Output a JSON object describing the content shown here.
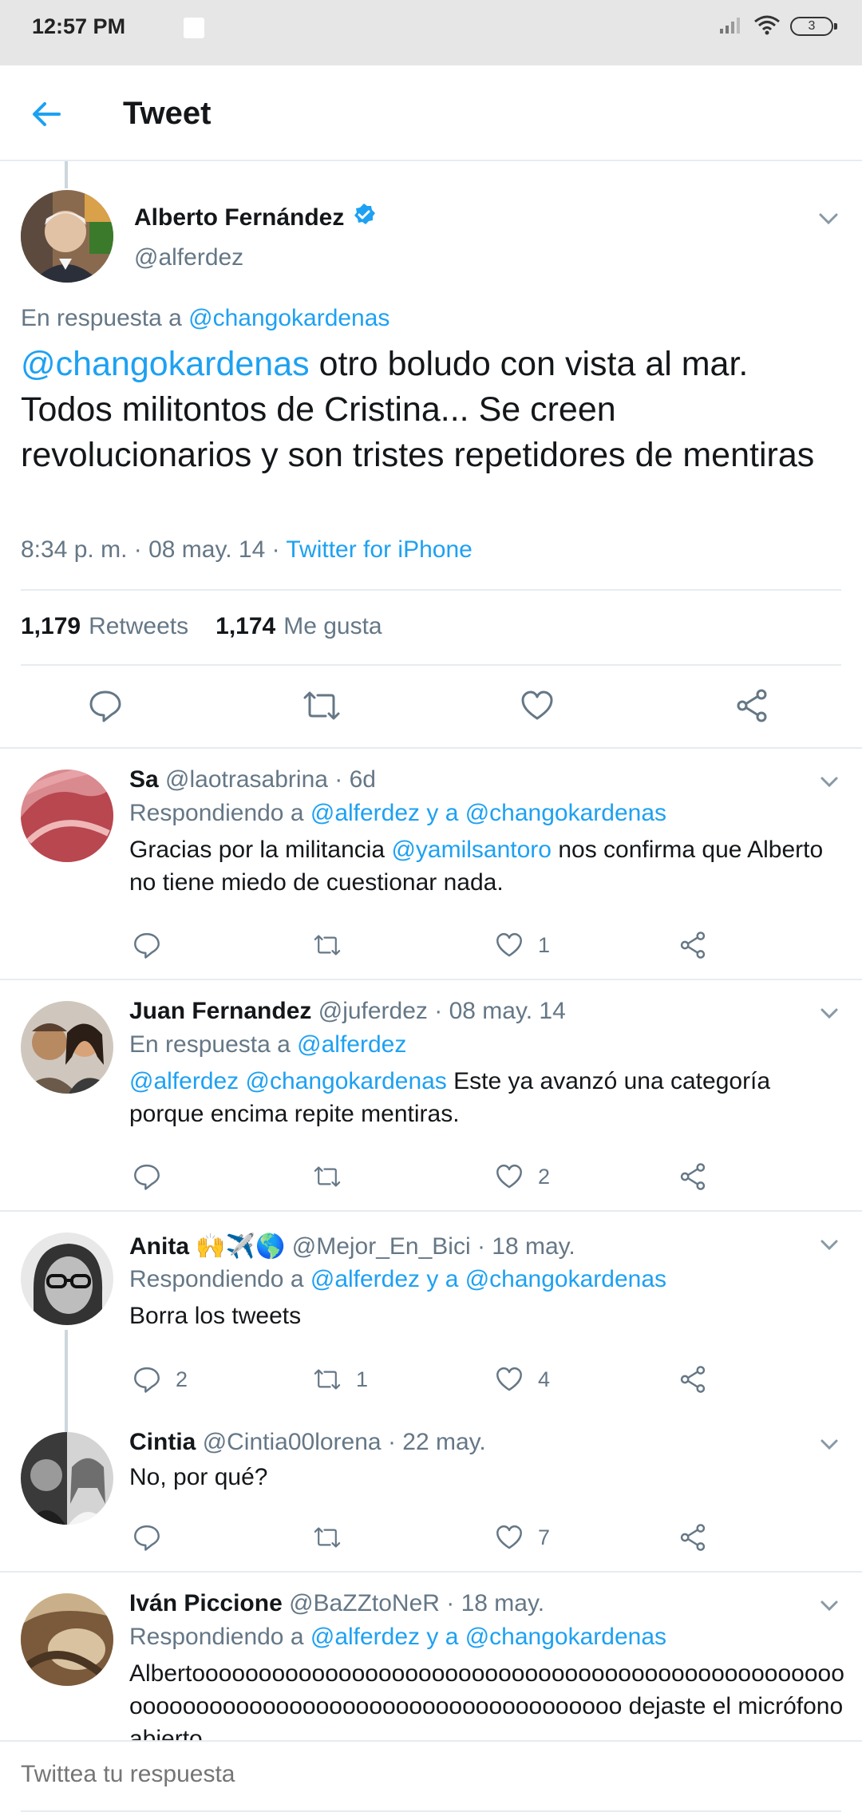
{
  "status_bar": {
    "time": "12:57 PM",
    "battery": "3"
  },
  "header": {
    "title": "Tweet"
  },
  "main_tweet": {
    "author_name": "Alberto Fernández",
    "handle": "@alferdez",
    "reply_prefix": "En respuesta a ",
    "reply_to": "@changokardenas",
    "mention": "@changokardenas",
    "text": " otro boludo con vista al mar. Todos militontos de Cristina... Se creen revolucionarios y son tristes repetidores de mentiras",
    "time": "8:34 p. m. · 08 may. 14 · ",
    "source": "Twitter for iPhone",
    "retweets_count": "1,179",
    "retweets_label": "Retweets",
    "likes_count": "1,174",
    "likes_label": "Me gusta"
  },
  "replies": [
    {
      "name": "Sa",
      "handle": "@laotrasabrina · 6d",
      "prefix": "Respondiendo a ",
      "to": "@alferdez y a @changokardenas",
      "text_a": "Gracias por la militancia ",
      "mention": "@yamilsantoro",
      "text_b": " nos confirma que Alberto no tiene miedo de cuestionar nada.",
      "replies": "",
      "retweets": "",
      "likes": "1"
    },
    {
      "name": "Juan Fernandez",
      "handle": "@juferdez · 08 may. 14",
      "prefix": "En respuesta a ",
      "to": "@alferdez",
      "mention": "@alferdez @changokardenas",
      "text_b": " Este ya avanzó una categoría porque encima repite mentiras.",
      "replies": "",
      "retweets": "",
      "likes": "2"
    },
    {
      "name": "Anita",
      "emoji": "🙌✈️🌎",
      "handle": "@Mejor_En_Bici · 18 may.",
      "prefix": "Respondiendo a ",
      "to": "@alferdez y a @changokardenas",
      "text": "Borra los tweets",
      "replies": "2",
      "retweets": "1",
      "likes": "4"
    },
    {
      "name": "Cintia",
      "handle": "@Cintia00lorena · 22 may.",
      "text": "No, por qué?",
      "replies": "",
      "retweets": "",
      "likes": "7"
    },
    {
      "name": "Iván Piccione",
      "handle": "@BaZZtoNeR · 18 may.",
      "prefix": "Respondiendo a ",
      "to": "@alferdez y a @changokardenas",
      "text": "Albertoooooooooooooooooooooooooooooooooooooooooooooooooooooooooooooooooooooooooooooooooooooo dejaste el micrófono abierto"
    }
  ],
  "reply_bar": {
    "placeholder": "Twittea tu respuesta"
  },
  "colors": {
    "accent": "#1da1f2",
    "muted": "#657786",
    "text": "#14171a",
    "border": "#e6ecf0"
  }
}
